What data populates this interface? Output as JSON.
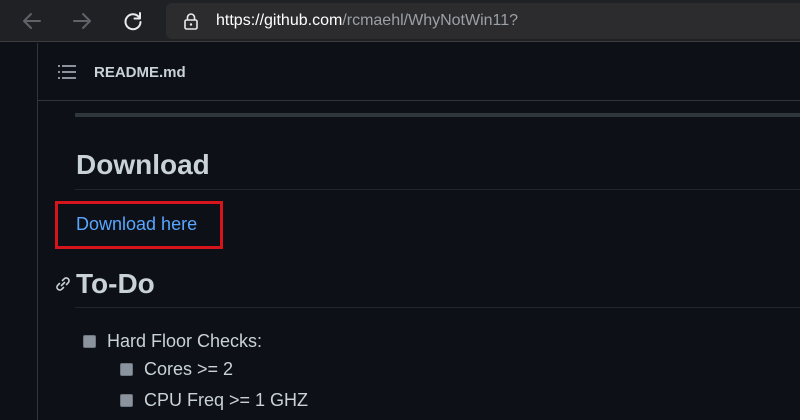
{
  "browser": {
    "url_host": "https://github.com",
    "url_path": "/rcmaehl/WhyNotWin11?",
    "icons": [
      "back-arrow-icon",
      "forward-arrow-icon",
      "reload-icon",
      "lock-icon"
    ]
  },
  "readme": {
    "filename": "README.md",
    "icon": "list-icon"
  },
  "sections": {
    "download_heading": "Download",
    "download_link": "Download here",
    "todo_heading": "To-Do",
    "anchor_icon": "link-icon"
  },
  "tasks": [
    {
      "label": "Hard Floor Checks:",
      "checked": false,
      "level": 0
    },
    {
      "label": "Cores >= 2",
      "checked": false,
      "level": 1
    },
    {
      "label": "CPU Freq >= 1 GHZ",
      "checked": false,
      "level": 1
    }
  ],
  "colors": {
    "page_bg": "#0d1117",
    "text": "#c9d1d9",
    "link": "#58a6ff",
    "highlight_box": "#d6141c",
    "toolbar_bg": "#202124"
  }
}
